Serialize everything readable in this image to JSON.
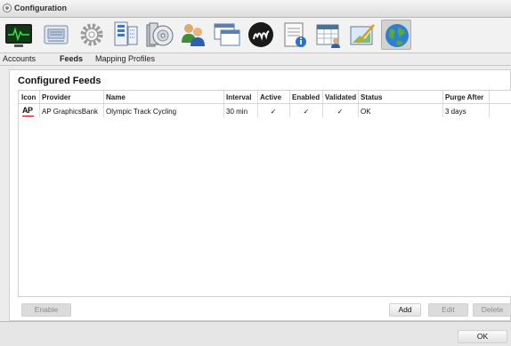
{
  "window": {
    "title": "Configuration"
  },
  "toolbar": {
    "items": [
      {
        "name": "monitor-icon"
      },
      {
        "name": "media-player-icon"
      },
      {
        "name": "settings-gear-icon"
      },
      {
        "name": "database-server-icon"
      },
      {
        "name": "cd-archive-icon"
      },
      {
        "name": "users-icon"
      },
      {
        "name": "windows-icon"
      },
      {
        "name": "brand-logo-icon"
      },
      {
        "name": "notepad-info-icon"
      },
      {
        "name": "calendar-user-icon"
      },
      {
        "name": "drawing-pen-icon"
      },
      {
        "name": "globe-icon",
        "active": true
      }
    ]
  },
  "tabs": [
    {
      "label": "Accounts",
      "active": false
    },
    {
      "label": "Feeds",
      "active": true
    },
    {
      "label": "Mapping Profiles",
      "active": false
    }
  ],
  "main": {
    "section_title": "Configured Feeds",
    "columns": [
      "Icon",
      "Provider",
      "Name",
      "Interval",
      "Active",
      "Enabled",
      "Validated",
      "Status",
      "Purge After"
    ],
    "rows": [
      {
        "icon_label": "AP",
        "provider": "AP GraphicsBank",
        "name": "Olympic Track Cycling",
        "interval": "30 min",
        "active": "✓",
        "enabled": "✓",
        "validated": "✓",
        "status": "OK",
        "purge_after": "3 days"
      }
    ]
  },
  "buttons": {
    "enable": "Enable",
    "add": "Add",
    "edit": "Edit",
    "delete": "Delete",
    "ok": "OK"
  },
  "colors": {
    "ap_underline": "#cc0000",
    "active_tool_bg": "#d2d2d2"
  }
}
